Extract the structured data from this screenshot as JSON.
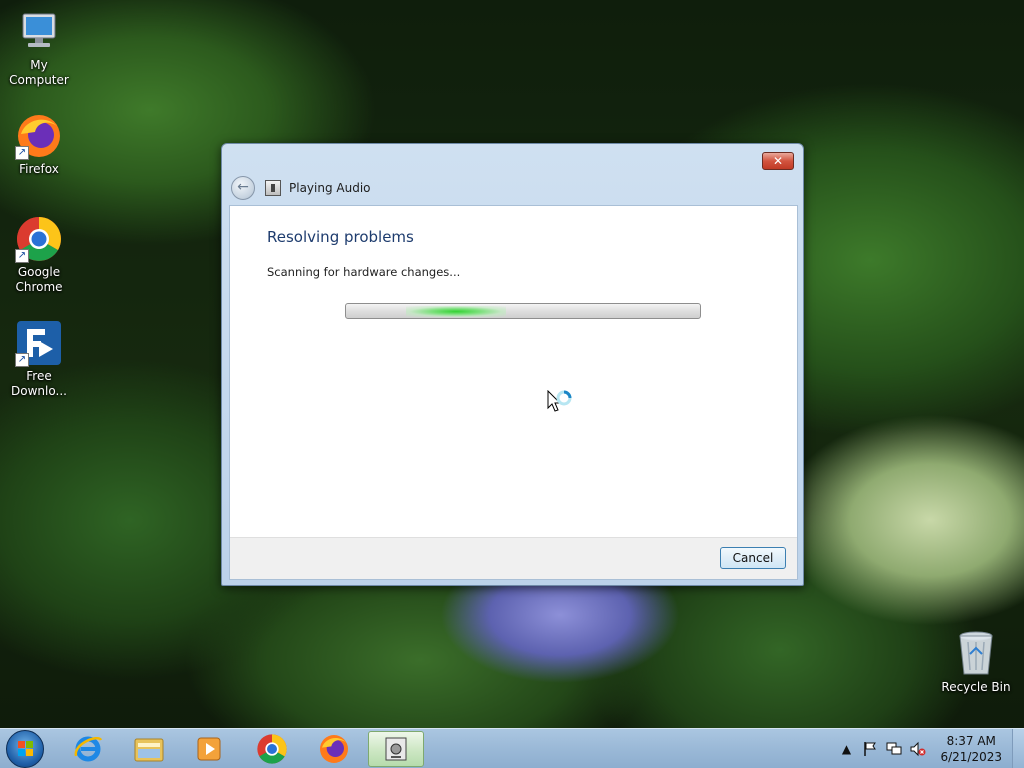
{
  "desktop": {
    "icons": [
      {
        "label": "My Computer",
        "icon": "computer-icon"
      },
      {
        "label": "Firefox",
        "icon": "firefox-icon"
      },
      {
        "label": "Google Chrome",
        "icon": "chrome-icon"
      },
      {
        "label": "Free Downlo...",
        "icon": "free-download-manager-icon"
      },
      {
        "label": "Recycle Bin",
        "icon": "recycle-bin-icon"
      }
    ]
  },
  "dialog": {
    "title": "Playing Audio",
    "heading": "Resolving problems",
    "status": "Scanning for hardware changes...",
    "progress_state": "indeterminate",
    "cancel_label": "Cancel",
    "close_glyph": "✕",
    "back_glyph": "←"
  },
  "taskbar": {
    "items": [
      {
        "icon": "internet-explorer-icon"
      },
      {
        "icon": "file-explorer-icon"
      },
      {
        "icon": "media-player-icon"
      },
      {
        "icon": "chrome-icon"
      },
      {
        "icon": "firefox-icon"
      },
      {
        "icon": "troubleshooter-icon",
        "active": true
      }
    ],
    "clock_time": "8:37 AM",
    "clock_date": "6/21/2023"
  },
  "colors": {
    "accent": "#1e3c6e",
    "progress_glow": "#32d232",
    "taskbar": "#9cbad8"
  }
}
